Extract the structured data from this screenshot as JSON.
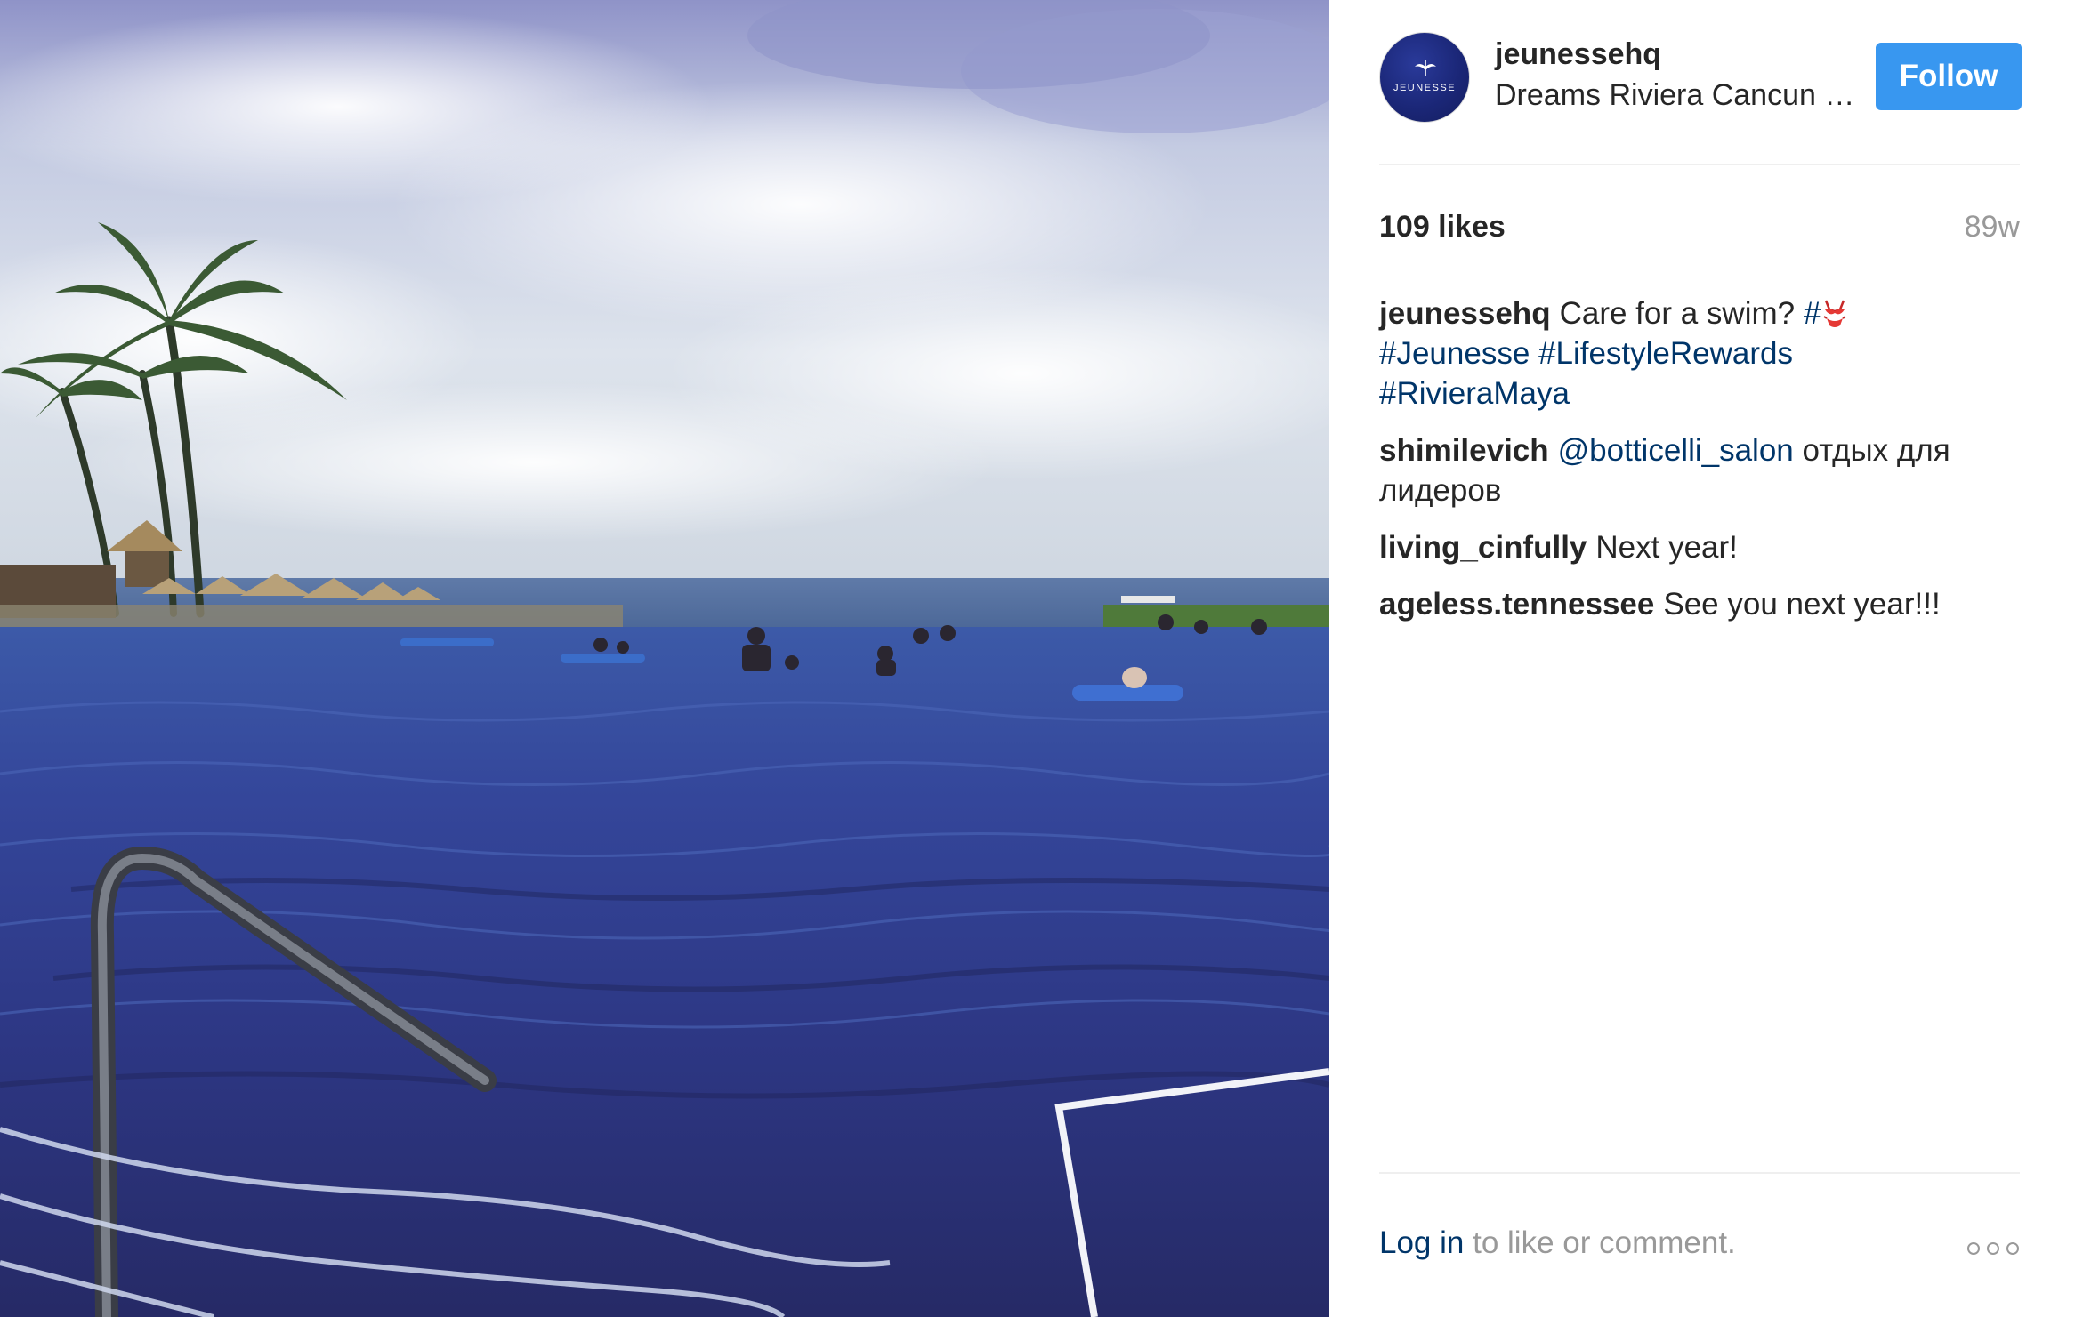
{
  "photo": {
    "alt_semantic": "post-photo"
  },
  "header": {
    "avatar_logo_text": "JEUNESSE",
    "username": "jeunessehq",
    "location": "Dreams Riviera Cancun Resort & Spa",
    "follow_label": "Follow"
  },
  "meta": {
    "likes": "109 likes",
    "time": "89w"
  },
  "caption": {
    "author": "jeunessehq",
    "text": "Care for a swim?",
    "hash_prefix": "#",
    "emoji_icon": "bikini-icon",
    "tags": [
      "#Jeunesse",
      "#LifestyleRewards",
      "#RivieraMaya"
    ]
  },
  "comments": [
    {
      "author": "shimilevich",
      "mention": "@botticelli_salon",
      "text": "отдых для лидеров"
    },
    {
      "author": "living_cinfully",
      "text": "Next year!"
    },
    {
      "author": "ageless.tennessee",
      "text": "See you next year!!!"
    }
  ],
  "footer": {
    "login_link": "Log in",
    "login_rest": "to like or comment.",
    "more_icon": "more-options-icon"
  },
  "colors": {
    "follow_bg": "#3897f0",
    "link": "#003569",
    "muted": "#999999",
    "text": "#262626"
  }
}
